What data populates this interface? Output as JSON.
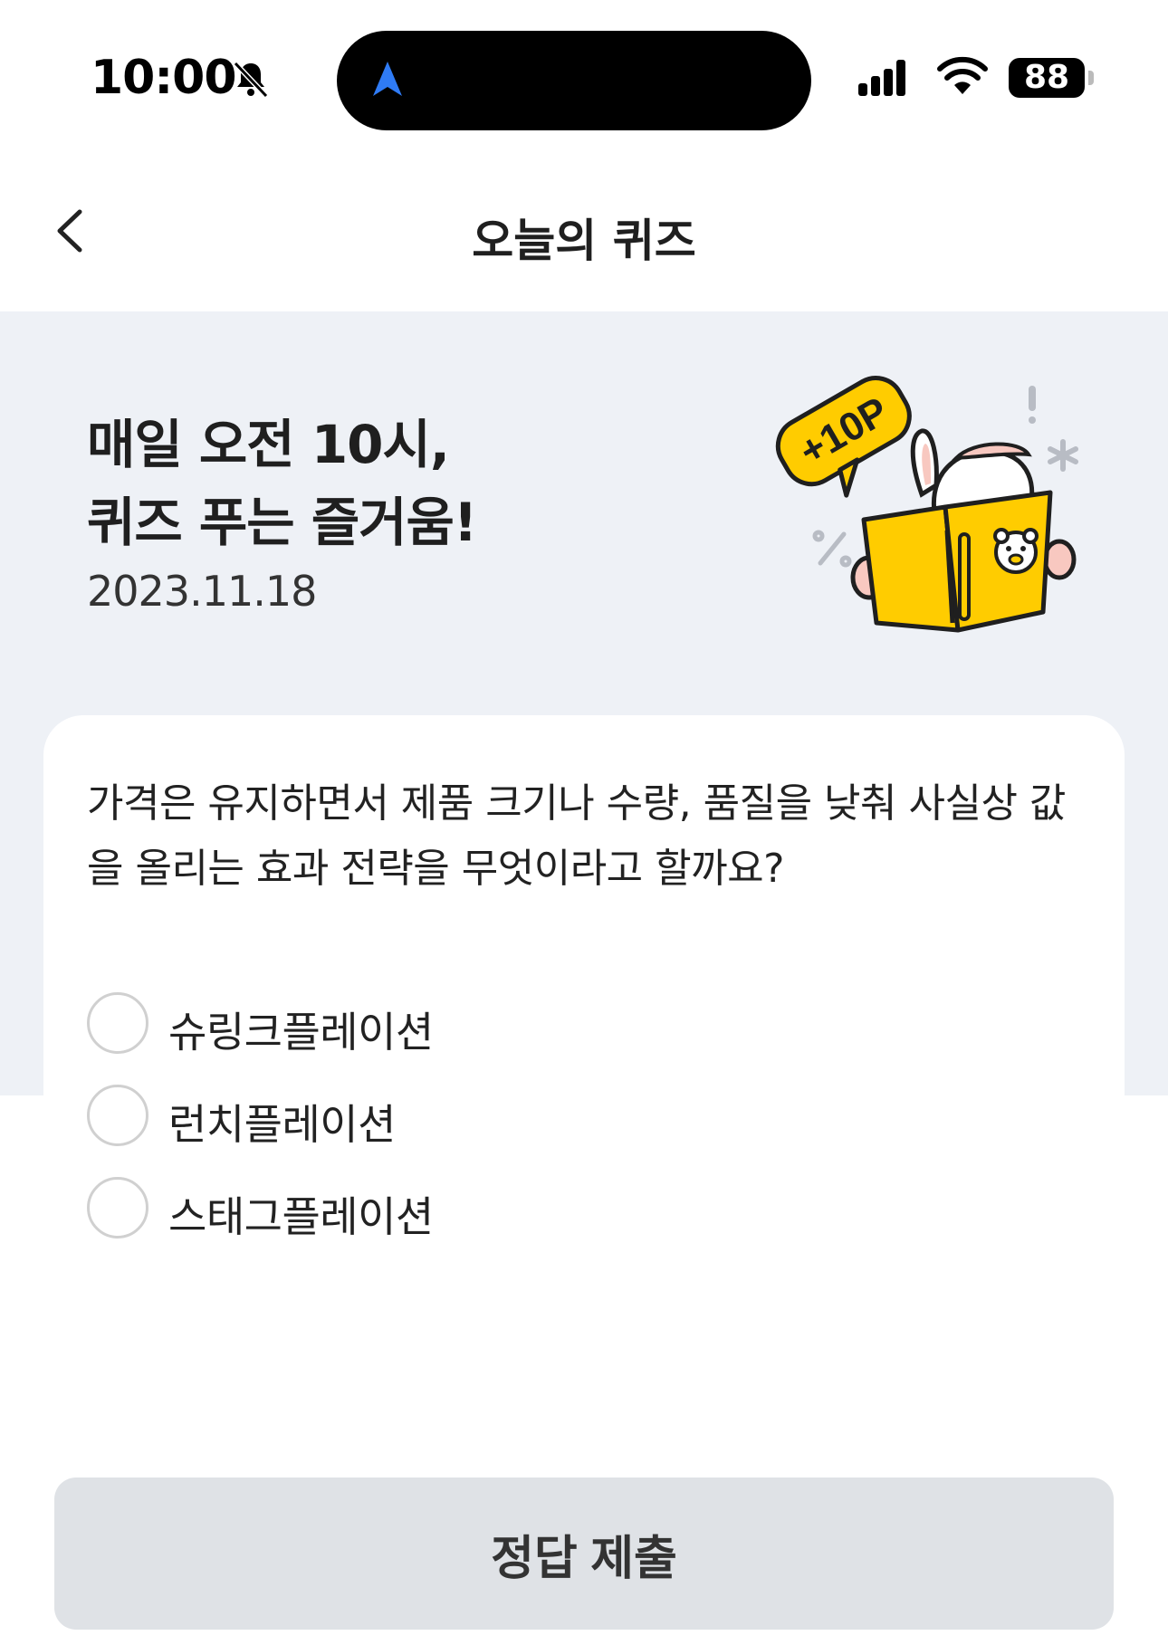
{
  "status_bar": {
    "time": "10:00",
    "battery": "88"
  },
  "header": {
    "title": "오늘의 퀴즈"
  },
  "hero": {
    "title_line1": "매일 오전 10시,",
    "title_line2": "퀴즈 푸는 즐거움!",
    "date": "2023.11.18",
    "badge": "+10P"
  },
  "quiz": {
    "question": "가격은 유지하면서 제품 크기나 수량, 품질을 낮춰 사실상 값을 올리는 효과 전략을 무엇이라고 할까요?",
    "options": [
      {
        "label": "슈링크플레이션",
        "selected": false
      },
      {
        "label": "런치플레이션",
        "selected": false
      },
      {
        "label": "스태그플레이션",
        "selected": false
      }
    ]
  },
  "submit": {
    "label": "정답 제출"
  },
  "colors": {
    "hero_bg": "#eef1f6",
    "button_bg": "#dfe2e6",
    "accent_yellow": "#ffcc00",
    "nav_blue": "#2f7bf5"
  }
}
